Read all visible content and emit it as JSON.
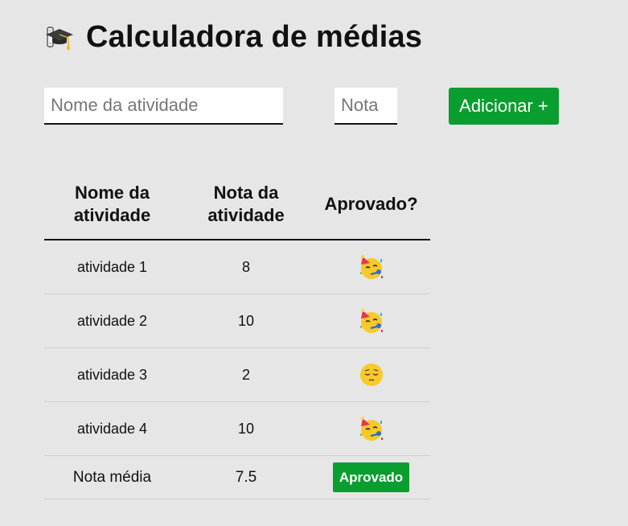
{
  "header": {
    "title": "Calculadora de médias",
    "icon": "graduation-cap-icon"
  },
  "form": {
    "name_placeholder": "Nome da atividade",
    "name_value": "",
    "grade_placeholder": "Nota",
    "grade_value": "",
    "add_label": "Adicionar +"
  },
  "table": {
    "headers": [
      "Nome da atividade",
      "Nota da atividade",
      "Aprovado?"
    ],
    "rows": [
      {
        "name": "atividade 1",
        "grade": "8",
        "approved": true,
        "icon": "partying-face-icon"
      },
      {
        "name": "atividade 2",
        "grade": "10",
        "approved": true,
        "icon": "partying-face-icon"
      },
      {
        "name": "atividade 3",
        "grade": "2",
        "approved": false,
        "icon": "pensive-face-icon"
      },
      {
        "name": "atividade 4",
        "grade": "10",
        "approved": true,
        "icon": "partying-face-icon"
      }
    ],
    "footer": {
      "label": "Nota média",
      "average": "7.5",
      "status": "Aprovado"
    }
  },
  "colors": {
    "accent": "#0a9d2f",
    "background": "#e6e6e6"
  }
}
